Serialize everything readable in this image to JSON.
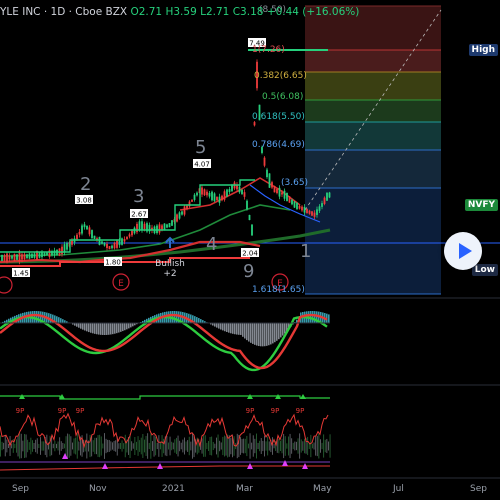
{
  "header": {
    "symbol": "YLE INC · 1D · Cboe BZX",
    "open_label": "O",
    "open": "2.71",
    "high_label": "H",
    "high": "3.59",
    "low_label": "L",
    "low": "2.71",
    "close_label": "C",
    "close": "3.18",
    "change": "+0.44 (+16.06%)"
  },
  "price_tags": {
    "high": "High",
    "ticker": "NVFY",
    "low": "Low"
  },
  "fib_levels": [
    {
      "label": "(8.50)"
    },
    {
      "label": "1(7.26)"
    },
    {
      "label": "0.382(6.65)"
    },
    {
      "label": "0.5(6.08)"
    },
    {
      "label": "0.618(5.50)"
    },
    {
      "label": "0.786(4.69)"
    },
    {
      "label": "(3.65)"
    },
    {
      "label": "1.618(1.65)"
    }
  ],
  "price_labels": {
    "p749": "7.49",
    "p407": "4.07",
    "p308": "3.08",
    "p267": "2.67",
    "p204": "2.04",
    "p180": "1.80",
    "p145": "1.45"
  },
  "wave_labels": {
    "w2": "2",
    "w3": "3",
    "w4": "4",
    "w5": "5",
    "w9": "9",
    "w1": "1",
    "e1": "E",
    "e2": "E"
  },
  "bullish": {
    "line1": "Bullish",
    "line2": "+2"
  },
  "setup_labels": {
    "nine": "9P"
  },
  "x_axis": [
    "Sep",
    "Nov",
    "2021",
    "Mar",
    "May",
    "Jul",
    "Sep"
  ],
  "colors": {
    "up": "#26d07c",
    "down": "#ef3b3b",
    "accent": "#2962ff",
    "fib_blue": "#2d6cc6"
  }
}
